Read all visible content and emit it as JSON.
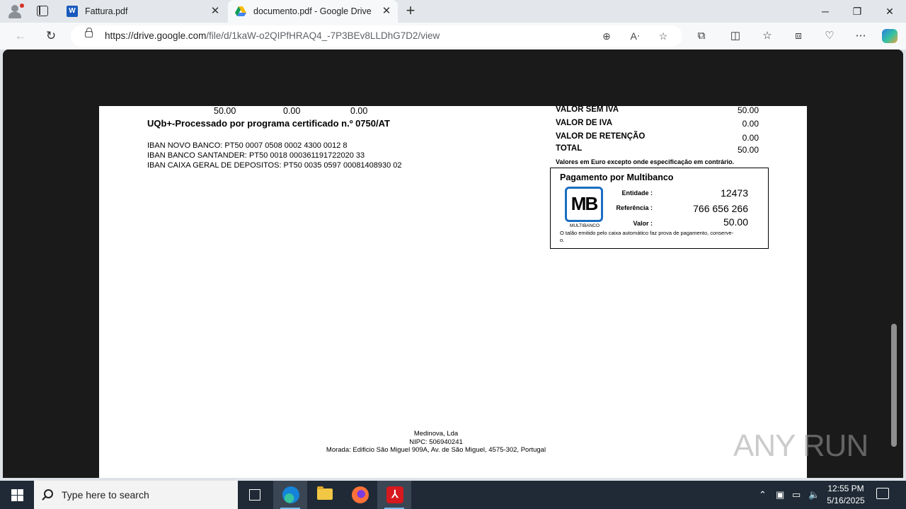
{
  "browser": {
    "tabs": [
      {
        "title": "Fattura.pdf",
        "icon": "word-icon"
      },
      {
        "title": "documento.pdf - Google Drive",
        "icon": "google-drive-icon"
      }
    ],
    "new_tab": "+",
    "url_host": "https://drive.google.com",
    "url_path": "/file/d/1kaW-o2QIPfHRAQ4_-7P3BEv8LLDhG7D2/view"
  },
  "document": {
    "amounts_row": [
      "50.00",
      "0.00",
      "0.00"
    ],
    "processed_line": "UQb+-Processado por programa certificado n.º 0750/AT",
    "ibans": [
      "IBAN NOVO BANCO: PT50 0007 0508 0002 4300 0012 8",
      "IBAN BANCO SANTANDER: PT50 0018 000361191722020 33",
      "IBAN CAIXA GERAL DE DEPOSITOS: PT50 0035 0597 00081408930 02"
    ],
    "totals": [
      {
        "label": "VALOR SEM IVA",
        "value": "50.00"
      },
      {
        "label": "VALOR DE IVA",
        "value": "0.00"
      },
      {
        "label": "VALOR DE RETENÇÃO",
        "value": "0.00"
      },
      {
        "label": "TOTAL",
        "value": "50.00"
      }
    ],
    "currency_note": "Valores em Euro excepto onde especificação em contrário.",
    "multibanco": {
      "title": "Pagamento por Multibanco",
      "logo_text": "MB",
      "logo_caption": "MULTIBANCO",
      "entidade_label": "Entidade :",
      "entidade": "12473",
      "referencia_label": "Referência :",
      "referencia": "766 656 266",
      "valor_label": "Valor :",
      "valor": "50.00",
      "footnote": "O talão emitido pelo caixa automático faz prova de pagamento, conserve-o."
    },
    "footer": {
      "company": "Medinova, Lda",
      "nipc": "NIPC: 506940241",
      "address": "Morada: Edificio São Miguel 909A, Av. de São Miguel, 4575-302, Portugal"
    }
  },
  "watermark": "ANY RUN",
  "taskbar": {
    "search_placeholder": "Type here to search",
    "time": "12:55 PM",
    "date": "5/16/2025"
  }
}
